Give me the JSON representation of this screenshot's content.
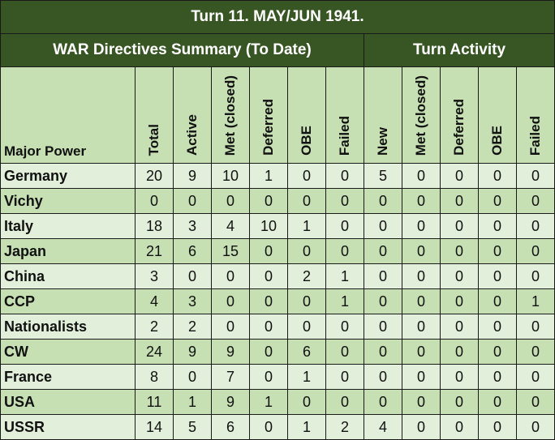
{
  "title": "Turn 11.  MAY/JUN 1941.",
  "groups": {
    "summary": "WAR Directives Summary (To Date)",
    "activity": "Turn Activity"
  },
  "columns": {
    "name": "Major Power",
    "summary": [
      "Total",
      "Active",
      "Met (closed)",
      "Deferred",
      "OBE",
      "Failed"
    ],
    "activity": [
      "New",
      "Met (closed)",
      "Deferred",
      "OBE",
      "Failed"
    ]
  },
  "rows": [
    {
      "power": "Germany",
      "values": [
        "20",
        "9",
        "10",
        "1",
        "0",
        "0",
        "5",
        "0",
        "0",
        "0",
        "0"
      ]
    },
    {
      "power": "Vichy",
      "values": [
        "0",
        "0",
        "0",
        "0",
        "0",
        "0",
        "0",
        "0",
        "0",
        "0",
        "0"
      ]
    },
    {
      "power": "Italy",
      "values": [
        "18",
        "3",
        "4",
        "10",
        "1",
        "0",
        "0",
        "0",
        "0",
        "0",
        "0"
      ]
    },
    {
      "power": "Japan",
      "values": [
        "21",
        "6",
        "15",
        "0",
        "0",
        "0",
        "0",
        "0",
        "0",
        "0",
        "0"
      ]
    },
    {
      "power": "China",
      "values": [
        "3",
        "0",
        "0",
        "0",
        "2",
        "1",
        "0",
        "0",
        "0",
        "0",
        "0"
      ]
    },
    {
      "power": "CCP",
      "values": [
        "4",
        "3",
        "0",
        "0",
        "0",
        "1",
        "0",
        "0",
        "0",
        "0",
        "1"
      ]
    },
    {
      "power": "Nationalists",
      "values": [
        "2",
        "2",
        "0",
        "0",
        "0",
        "0",
        "0",
        "0",
        "0",
        "0",
        "0"
      ]
    },
    {
      "power": "CW",
      "values": [
        "24",
        "9",
        "9",
        "0",
        "6",
        "0",
        "0",
        "0",
        "0",
        "0",
        "0"
      ]
    },
    {
      "power": "France",
      "values": [
        "8",
        "0",
        "7",
        "0",
        "1",
        "0",
        "0",
        "0",
        "0",
        "0",
        "0"
      ]
    },
    {
      "power": "USA",
      "values": [
        "11",
        "1",
        "9",
        "1",
        "0",
        "0",
        "0",
        "0",
        "0",
        "0",
        "0"
      ]
    },
    {
      "power": "USSR",
      "values": [
        "14",
        "5",
        "6",
        "0",
        "1",
        "2",
        "4",
        "0",
        "0",
        "0",
        "0"
      ]
    }
  ]
}
